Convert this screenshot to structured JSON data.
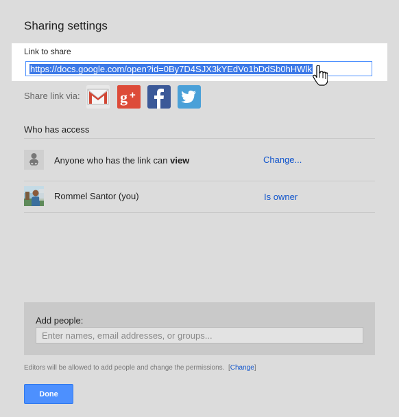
{
  "dialog": {
    "title": "Sharing settings"
  },
  "link_share": {
    "label": "Link to share",
    "url": "https://docs.google.com/open?id=0By7D4SJX3kYEdVo1bDdSb0hHWlk"
  },
  "share_via": {
    "label": "Share link via:",
    "services": [
      "gmail-icon",
      "google-plus-icon",
      "facebook-icon",
      "twitter-icon"
    ],
    "colors": {
      "gmail": "#d14836",
      "google_plus": "#dd4b39",
      "facebook": "#3b5998",
      "twitter": "#55acee"
    }
  },
  "access": {
    "title": "Who has access",
    "rows": [
      {
        "prefix": "Anyone who has the link can ",
        "bold": "view",
        "action": "Change..."
      },
      {
        "name": "Rommel Santor (you)",
        "role": "Is owner"
      }
    ]
  },
  "add_people": {
    "label": "Add people:",
    "placeholder": "Enter names, email addresses, or groups..."
  },
  "editors_note": {
    "text": "Editors will be allowed to add people and change the permissions.",
    "open_bracket": "[",
    "change_link": "Change",
    "close_bracket": "]"
  },
  "done_button": {
    "label": "Done"
  },
  "accent_color": "#4d90fe",
  "link_color": "#1155cc"
}
